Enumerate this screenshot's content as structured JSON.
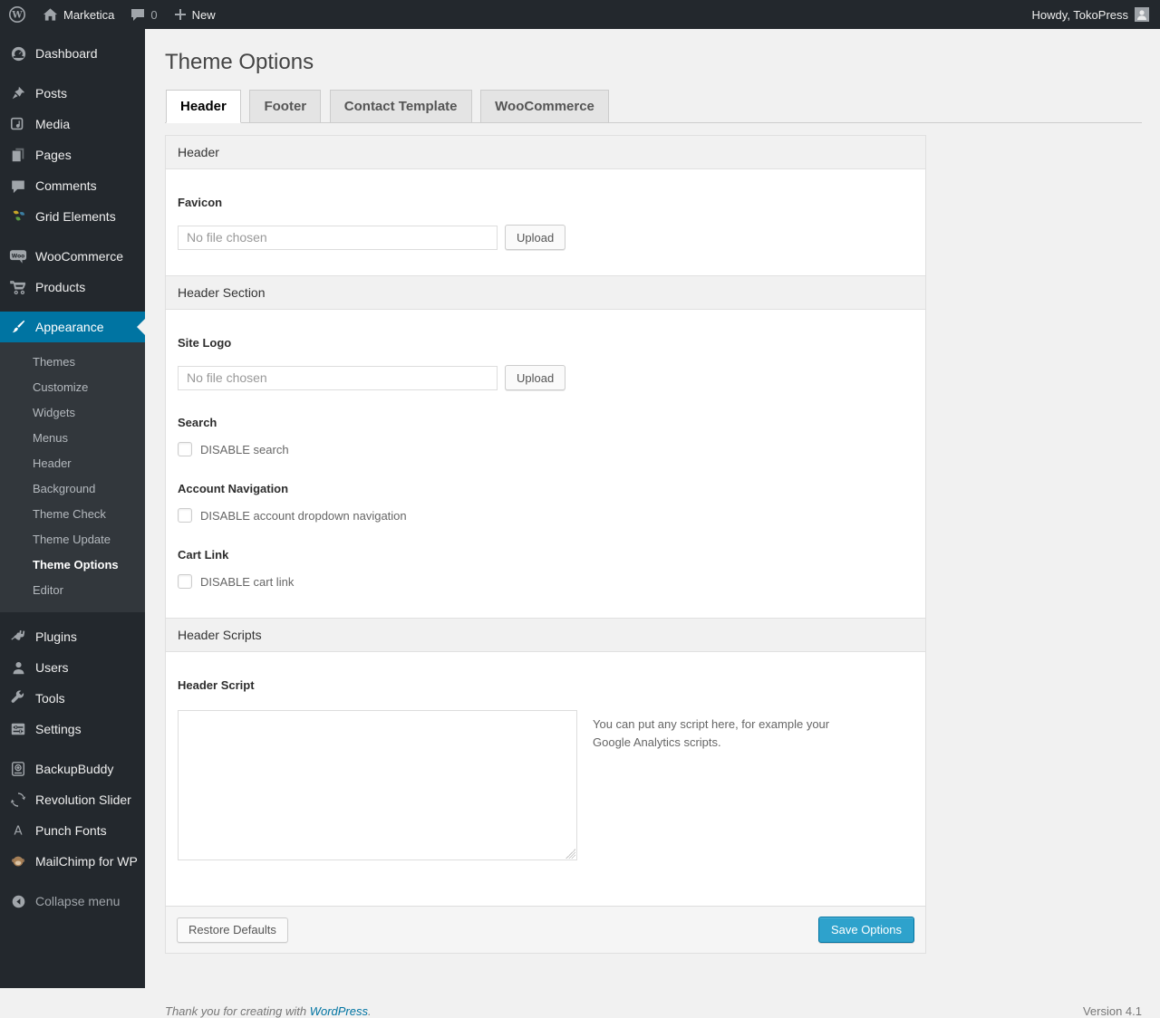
{
  "colors": {
    "accent": "#0074a2",
    "primary_button": "#2ea2cc",
    "menu_bg": "#23282d",
    "page_bg": "#f1f1f1"
  },
  "admin_bar": {
    "site_name": "Marketica",
    "comments_count": "0",
    "new_label": "New",
    "howdy": "Howdy, TokoPress"
  },
  "sidebar": {
    "items": [
      {
        "label": "Dashboard"
      },
      {
        "label": "Posts"
      },
      {
        "label": "Media"
      },
      {
        "label": "Pages"
      },
      {
        "label": "Comments"
      },
      {
        "label": "Grid Elements"
      },
      {
        "label": "WooCommerce"
      },
      {
        "label": "Products"
      },
      {
        "label": "Appearance"
      },
      {
        "label": "Plugins"
      },
      {
        "label": "Users"
      },
      {
        "label": "Tools"
      },
      {
        "label": "Settings"
      },
      {
        "label": "BackupBuddy"
      },
      {
        "label": "Revolution Slider"
      },
      {
        "label": "Punch Fonts"
      },
      {
        "label": "MailChimp for WP"
      },
      {
        "label": "Collapse menu"
      }
    ],
    "appearance_submenu": [
      "Themes",
      "Customize",
      "Widgets",
      "Menus",
      "Header",
      "Background",
      "Theme Check",
      "Theme Update",
      "Theme Options",
      "Editor"
    ]
  },
  "page": {
    "title": "Theme Options",
    "tabs": [
      "Header",
      "Footer",
      "Contact Template",
      "WooCommerce"
    ]
  },
  "panel": {
    "section_header_title": "Header",
    "favicon_label": "Favicon",
    "favicon_value": "No file chosen",
    "upload_label": "Upload",
    "section_header_section_title": "Header Section",
    "site_logo_label": "Site Logo",
    "site_logo_value": "No file chosen",
    "search_label": "Search",
    "search_checkbox_label": "DISABLE search",
    "account_nav_label": "Account Navigation",
    "account_nav_checkbox_label": "DISABLE account dropdown navigation",
    "cart_link_label": "Cart Link",
    "cart_link_checkbox_label": "DISABLE cart link",
    "section_header_scripts_title": "Header Scripts",
    "header_script_label": "Header Script",
    "header_script_help": "You can put any script here, for example your Google Analytics scripts.",
    "restore_defaults_label": "Restore Defaults",
    "save_options_label": "Save Options"
  },
  "footer": {
    "thanks_prefix": "Thank you for creating with ",
    "wordpress_link": "WordPress",
    "thanks_suffix": ".",
    "version": "Version 4.1"
  }
}
